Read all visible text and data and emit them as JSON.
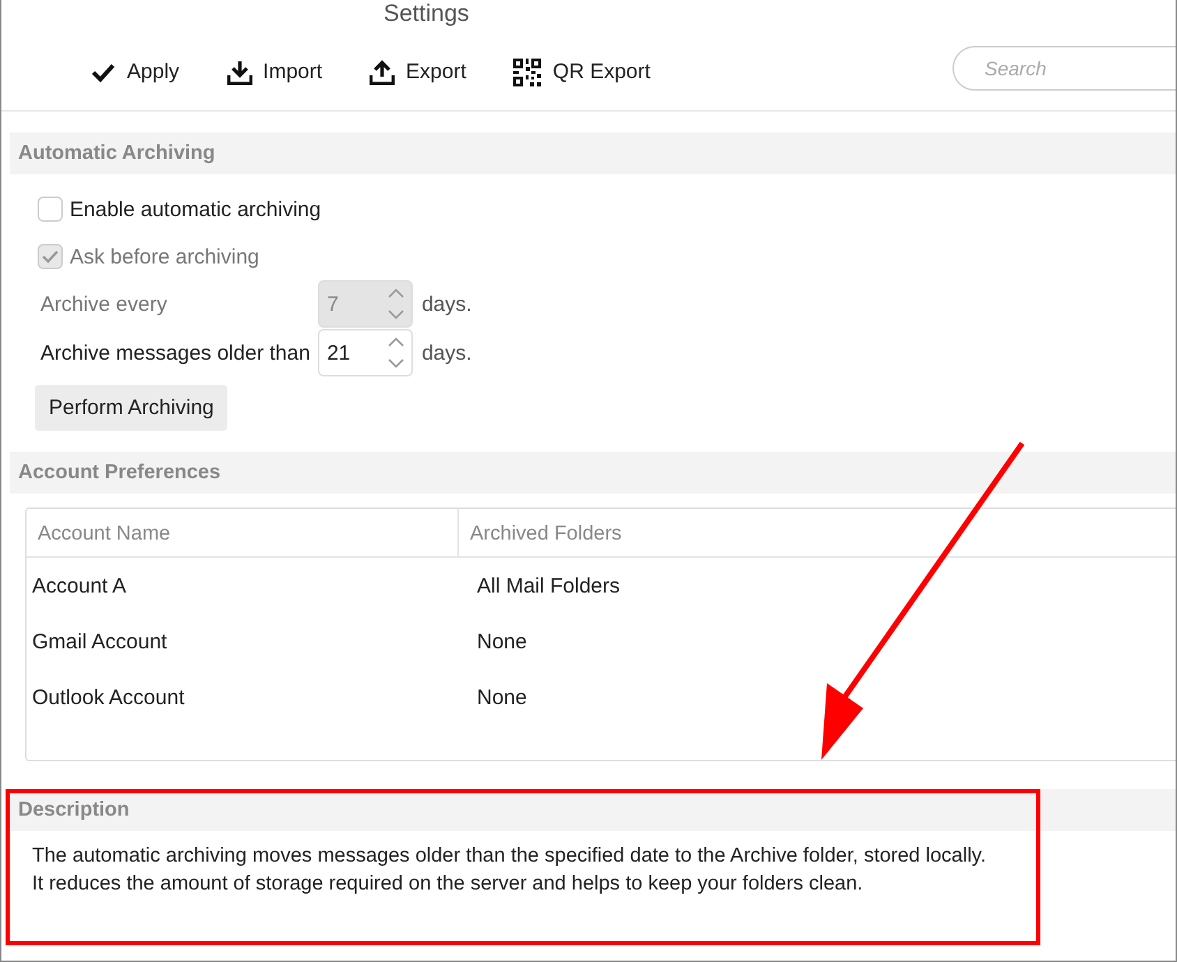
{
  "window": {
    "title": "Settings"
  },
  "toolbar": [
    {
      "kind": "check",
      "label": "Apply"
    },
    {
      "kind": "import",
      "label": "Import"
    },
    {
      "kind": "export",
      "label": "Export"
    },
    {
      "kind": "qr",
      "label": "QR Export"
    }
  ],
  "search": {
    "placeholder": "Search"
  },
  "automatic_archiving": {
    "title": "Automatic Archiving",
    "checkboxes": [
      {
        "label": "Enable automatic archiving",
        "checked": false,
        "disabled": false
      },
      {
        "label": "Ask before archiving",
        "checked": true,
        "disabled": true
      }
    ],
    "spinners": [
      {
        "label": "Archive every",
        "value": "7",
        "unit": "days.",
        "disabled": true
      },
      {
        "label": "Archive messages older than",
        "value": "21",
        "unit": "days.",
        "disabled": false
      }
    ],
    "button": "Perform Archiving"
  },
  "account_preferences": {
    "title": "Account Preferences",
    "columns": [
      "Account Name",
      "Archived Folders"
    ],
    "rows": [
      [
        "Account A",
        "All Mail Folders"
      ],
      [
        "Gmail Account",
        "None"
      ],
      [
        "Outlook Account",
        "None"
      ]
    ]
  },
  "description": {
    "title": "Description",
    "lines": [
      "The automatic archiving moves messages older than the specified date to the Archive folder, stored locally.",
      "It reduces the amount of storage required on the server and helps to keep your folders clean."
    ]
  }
}
